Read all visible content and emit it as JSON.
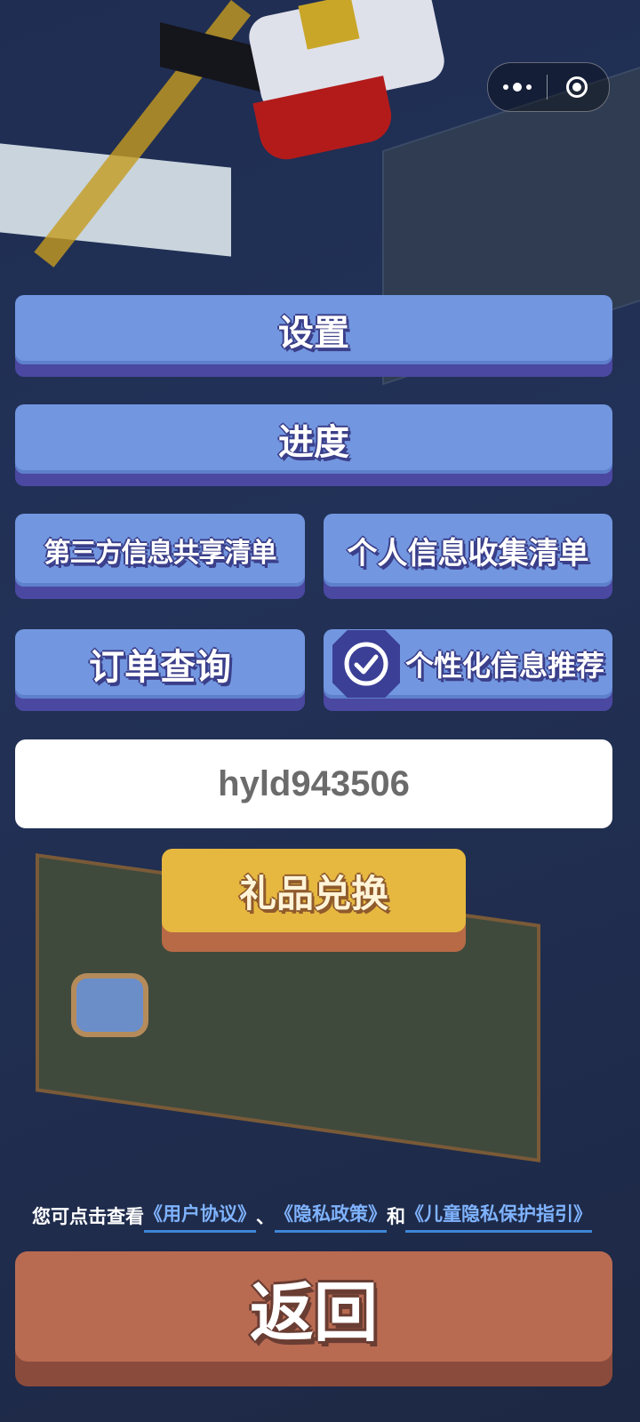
{
  "header": {
    "more_icon": "more-dots-icon",
    "close_icon": "target-circle-icon"
  },
  "menu": {
    "settings_label": "设置",
    "progress_label": "进度",
    "third_party_label": "第三方信息共享清单",
    "personal_info_label": "个人信息收集清单",
    "order_query_label": "订单查询",
    "personalized_label": "个性化信息推荐",
    "personalized_checked": true
  },
  "user": {
    "code": "hyld943506"
  },
  "gift": {
    "label": "礼品兑换"
  },
  "agreement": {
    "prefix": "您可点击查看",
    "user_agreement": "《用户协议》",
    "separator": "、",
    "privacy_policy": "《隐私政策》",
    "and": "和",
    "child_privacy": "《儿童隐私保护指引》"
  },
  "footer": {
    "back_label": "返回"
  },
  "colors": {
    "button_blue": "#7297e0",
    "button_shadow": "#4a48a0",
    "gift_yellow": "#e6b840",
    "back_red": "#b96b52",
    "link_blue": "#7fb3ff"
  }
}
